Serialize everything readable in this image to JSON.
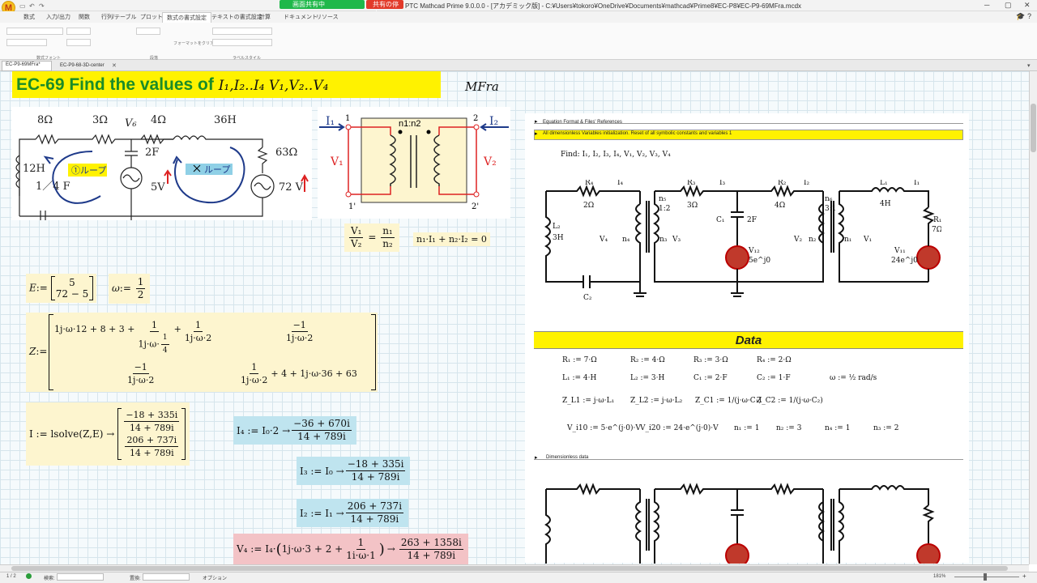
{
  "titlebar": {
    "share_label": "画面共有中",
    "stop_label": "共有の停止",
    "title": "PTC Mathcad Prime 9.0.0.0 - [アカデミック版] - C:¥Users¥tokoro¥OneDrive¥Documents¥mathcad¥Prime8¥EC-P8¥EC-P9-69MFra.mcdx"
  },
  "ribbon": {
    "tabs": [
      "数式",
      "入力/出力",
      "関数",
      "行列/テーブル",
      "プロット",
      "数式の書式設定",
      "テキストの書式設定",
      "計算",
      "ドキュメント",
      "リソース"
    ],
    "active_tab": "数式の書式設定",
    "group_labels": [
      "数式フォント",
      "段落",
      "ラベルスタイル"
    ],
    "format_painter": "フォーマットをクリア"
  },
  "doc_tabs": [
    "EC-P9-69MFra*",
    "EC-P9-68-3D-center"
  ],
  "heading": {
    "text": "EC-69 Find the values of ",
    "math": "I₁,I₂..I₄ V₁,V₂..V₄"
  },
  "author": "MFra",
  "circuit_left": {
    "labels": [
      "8Ω",
      "3Ω",
      "V₆",
      "4Ω",
      "36H",
      "2F",
      "63Ω",
      "12H",
      "1／4 F",
      "5V",
      "72 V"
    ],
    "loop1": "①ループ",
    "loop2": "ループ"
  },
  "transformer": {
    "labels": [
      "I₁",
      "1",
      "I₂",
      "2",
      "n1:n2",
      "V₁",
      "V₂",
      "1'",
      "2'"
    ]
  },
  "eq_ratio": {
    "lhs_num": "V₁",
    "lhs_den": "V₂",
    "rhs_num": "n₁",
    "rhs_den": "n₂",
    "eq": "="
  },
  "eq_current": "n₁·I₁ + n₂·I₂ = 0",
  "E_def": {
    "name": "E",
    "assign": ":=",
    "values": [
      "5",
      "72 − 5"
    ]
  },
  "omega_def": {
    "name": "ω",
    "assign": ":=",
    "num": "1",
    "den": "2"
  },
  "Z_def": {
    "name": "Z",
    "assign": ":=",
    "r1c1_a": "1j·ω·12 + 8 + 3 +",
    "r1c1_n1": "1",
    "r1c1_d1": "1j·ω·",
    "r1c1_d1b": "1",
    "r1c1_d1c": "4",
    "r1c1_plus": "+",
    "r1c1_n2": "1",
    "r1c1_d2": "1j·ω·2",
    "r1c2_n": "−1",
    "r1c2_d": "1j·ω·2",
    "r2c1_n": "−1",
    "r2c1_d": "1j·ω·2",
    "r2c2_n": "1",
    "r2c2_d": "1j·ω·2",
    "r2c2_rest": "+ 4 + 1j·ω·36 + 63"
  },
  "I_def": {
    "lhs": "I := lsolve(Z,E) →",
    "r1n": "−18 + 335i",
    "r1d": "14 + 789i",
    "r2n": "206 + 737i",
    "r2d": "14 + 789i"
  },
  "I4": {
    "lhs": "I₄ := I₀·2 →",
    "num": "−36 + 670i",
    "den": "14 + 789i"
  },
  "I3": {
    "lhs": "I₃ := I₀ →",
    "num": "−18 + 335i",
    "den": "14 + 789i"
  },
  "I2": {
    "lhs": "I₂ := I₁ →",
    "num": "206 + 737i",
    "den": "14 + 789i"
  },
  "V4": {
    "lhs": "V₄ := I₄·",
    "paren_a": "1j·ω·3 + 2 +",
    "n": "1",
    "d": "1i·ω·1",
    "arrow": "→",
    "num": "263 + 1358i",
    "den": "14 + 789i"
  },
  "right_panel": {
    "header1": "Equation Format & Files' References",
    "header2": "All dimensionless Variables initialization. Reset of all symbolic constants and variables 1",
    "find": "Find: I₁, I₂, I₃, I₄, V₁, V₂, V₃, V₄",
    "circuit_labels": [
      "R₄",
      "2Ω",
      "I₄",
      "R₃",
      "3Ω",
      "I₃",
      "R₂",
      "4Ω",
      "I₂",
      "L₁",
      "4H",
      "I₁",
      "L₂",
      "3H",
      "C₁",
      "2F",
      "C₂",
      "R₁",
      "7Ω",
      "V₁₂",
      "5e^j0",
      "V₁₁",
      "24e^j0",
      "n₅",
      "1:2",
      "n₆",
      "3:1",
      "V₄",
      "V₃",
      "V₂",
      "V₁",
      "n₄",
      "n₃",
      "n₂",
      "n₁"
    ],
    "data_title": "Data",
    "data_rows": [
      [
        "R₁ := 7·Ω",
        "R₂ := 4·Ω",
        "R₃ := 3·Ω",
        "R₄ := 2·Ω"
      ],
      [
        "L₁ := 4·H",
        "L₂ := 3·H",
        "C₁ := 2·F",
        "C₂ := 1·F",
        "ω := ½ rad/s"
      ],
      [
        "Z_L1 := j·ω·L₁",
        "Z_L2 := j·ω·L₂",
        "Z_C1 := 1/(j·ω·C₁)",
        "Z_C2 := 1/(j·ω·C₂)"
      ],
      [
        "V_i10 := 5·e^(j·0)·V",
        "V_i20 := 24·e^(j·0)·V",
        "n₁ := 1",
        "n₂ := 3",
        "n₄ := 1",
        "n₃ := 2"
      ]
    ],
    "header3": "Dimensionless data"
  },
  "statusbar": {
    "page": "1 / 2",
    "search_label": "検索:",
    "replace_label": "置換:",
    "options": "オプション",
    "zoom": "181%"
  }
}
